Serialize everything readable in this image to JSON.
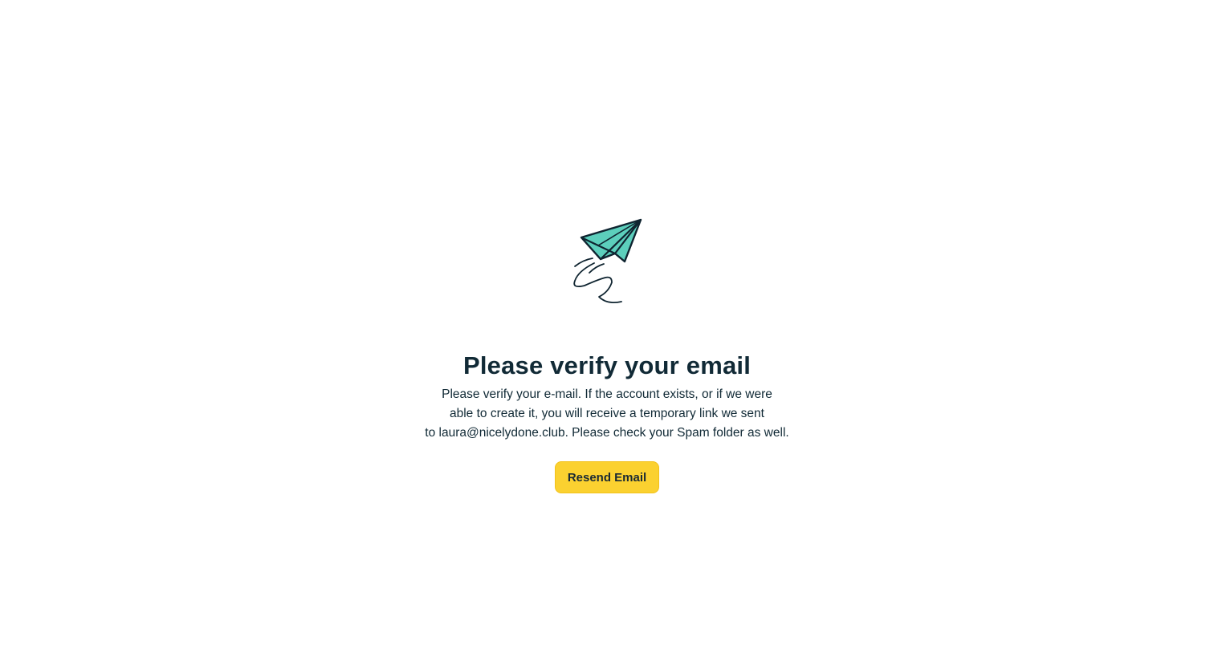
{
  "illustration": {
    "icon": "paper-plane-icon",
    "accent_color": "#5ccfbc",
    "stroke_color": "#0f2430"
  },
  "verify": {
    "title": "Please verify your email",
    "message_lines": [
      "Please verify your e-mail. If the account exists, or if we were",
      "able to create it, you will receive a temporary link we sent",
      "to laura@nicelydone.club. Please check your Spam folder as well."
    ],
    "resend_label": "Resend Email",
    "button_color": "#fbd130"
  }
}
